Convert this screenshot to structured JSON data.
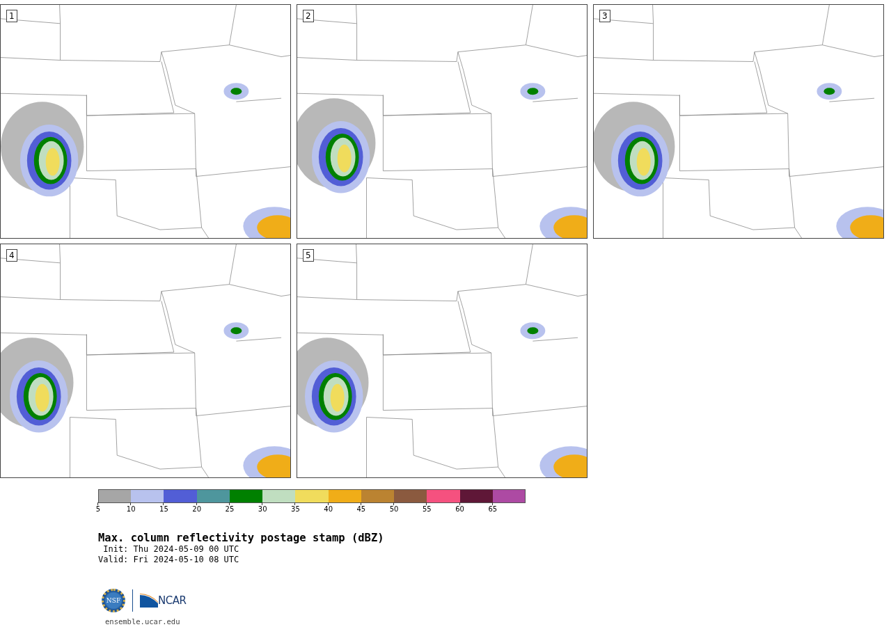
{
  "panels": [
    {
      "label": "1",
      "kind": "picture"
    },
    {
      "label": "2",
      "kind": "picture"
    },
    {
      "label": "3",
      "kind": "picture"
    },
    {
      "label": "4",
      "kind": "picture"
    },
    {
      "label": "5",
      "kind": "picture"
    }
  ],
  "colorbar": {
    "bins": [
      {
        "color": "#a6a6a6",
        "tick": "5"
      },
      {
        "color": "#b8c2ee",
        "tick": "10"
      },
      {
        "color": "#525ed6",
        "tick": "15"
      },
      {
        "color": "#4e969d",
        "tick": "20"
      },
      {
        "color": "#008000",
        "tick": "25"
      },
      {
        "color": "#c0dec0",
        "tick": "30"
      },
      {
        "color": "#f0dc5c",
        "tick": "35"
      },
      {
        "color": "#f0ad18",
        "tick": "40"
      },
      {
        "color": "#bb8331",
        "tick": "45"
      },
      {
        "color": "#8b5a3f",
        "tick": "50"
      },
      {
        "color": "#f5517f",
        "tick": "55"
      },
      {
        "color": "#5f1737",
        "tick": "60"
      },
      {
        "color": "#ad4aa3",
        "tick": "65"
      }
    ]
  },
  "title": "Max. column reflectivity postage stamp (dBZ)",
  "init": " Init: Thu 2024-05-09 00 UTC",
  "valid": "Valid: Fri 2024-05-10 08 UTC",
  "logos": {
    "nsf": "NSF",
    "ncar": "NCAR"
  },
  "site": "ensemble.ucar.edu"
}
